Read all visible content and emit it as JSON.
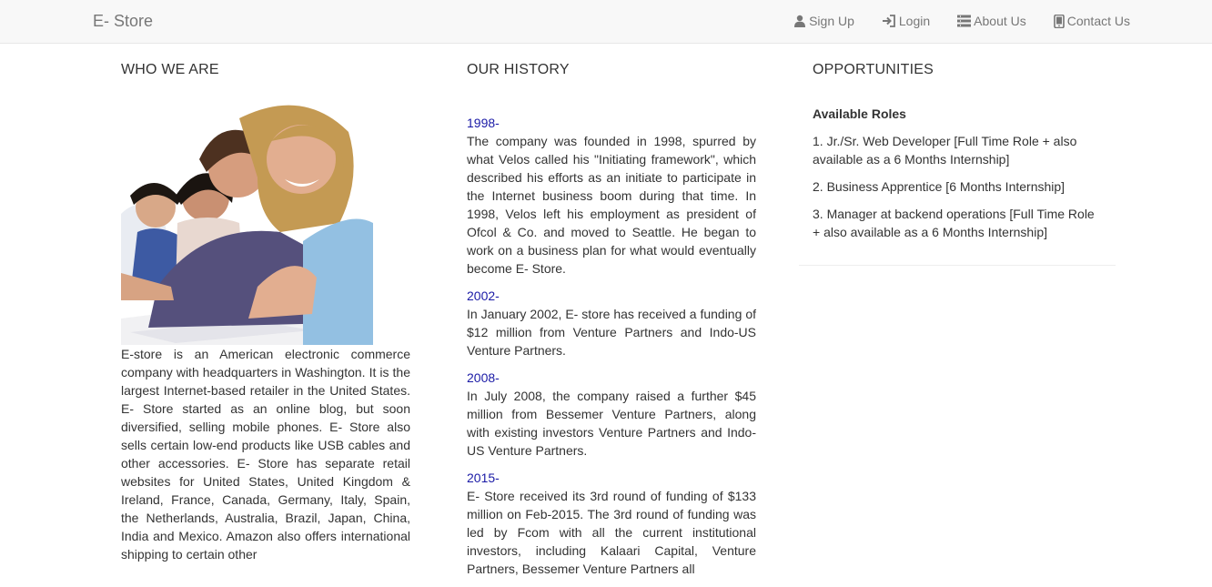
{
  "nav": {
    "brand": "E- Store",
    "links": [
      {
        "label": "Sign Up",
        "icon": "user-icon"
      },
      {
        "label": "Login",
        "icon": "login-icon"
      },
      {
        "label": "About Us",
        "icon": "list-icon"
      },
      {
        "label": "Contact Us",
        "icon": "phone-icon"
      }
    ]
  },
  "who": {
    "heading": "WHO WE ARE",
    "body": "E-store is an American electronic commerce company with headquarters in Washington. It is the largest Internet-based retailer in the United States. E- Store started as an online blog, but soon diversified, selling mobile phones. E- Store also sells certain low-end products like USB cables and other accessories. E- Store has separate retail websites for United States, United Kingdom & Ireland, France, Canada, Germany, Italy, Spain, the Netherlands, Australia, Brazil, Japan, China, India and Mexico. Amazon also offers international shipping to certain other"
  },
  "history": {
    "heading": "OUR HISTORY",
    "entries": [
      {
        "year": "1998-",
        "text": "The company was founded in 1998, spurred by what Velos called his \"Initiating framework\", which described his efforts as an initiate to participate in the Internet business boom during that time. In 1998, Velos left his employment as president of Ofcol & Co. and moved to Seattle. He began to work on a business plan for what would eventually become E- Store."
      },
      {
        "year": "2002-",
        "text": "In January 2002, E- store has received a funding of $12 million from Venture Partners and Indo-US Venture Partners."
      },
      {
        "year": "2008-",
        "text": "In July 2008, the company raised a further $45 million from Bessemer Venture Partners, along with existing investors Venture Partners and Indo-US Venture Partners."
      },
      {
        "year": "2015-",
        "text": "E- Store received its 3rd round of funding of $133 million on Feb-2015. The 3rd round of funding was led by Fcom with all the current institutional investors, including Kalaari Capital, Venture Partners, Bessemer Venture Partners all"
      }
    ]
  },
  "opportunities": {
    "heading": "OPPORTUNITIES",
    "roles_title": "Available Roles",
    "roles": [
      "1. Jr./Sr. Web Developer [Full Time Role + also available as a 6 Months Internship]",
      "2. Business Apprentice [6 Months Internship]",
      "3. Manager at backend operations [Full Time Role + also available as a 6 Months Internship]"
    ]
  },
  "colors": {
    "navbar_bg": "#f8f8f8",
    "nav_text": "#777777",
    "year_link": "#1a1aa6",
    "body_text": "#333333"
  }
}
